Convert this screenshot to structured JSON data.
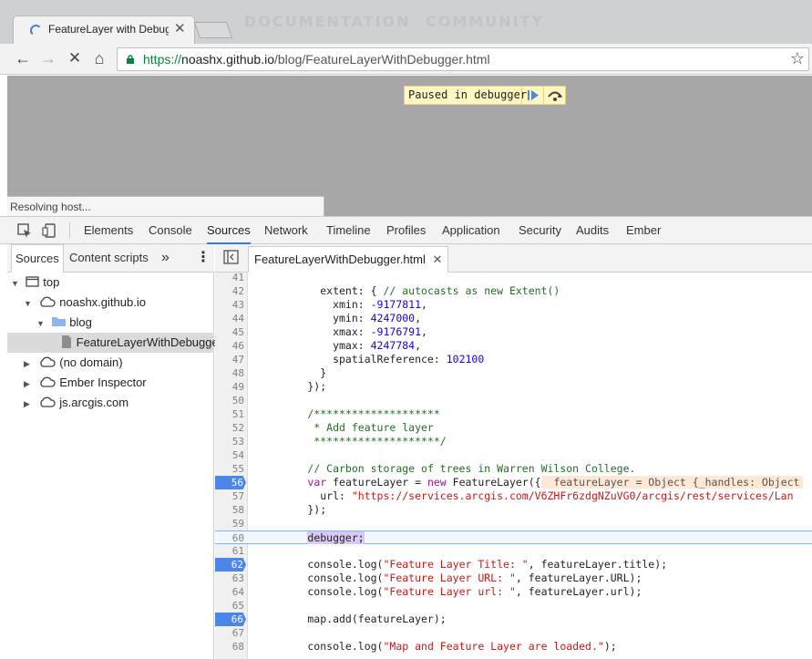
{
  "browser": {
    "tab_title": "FeatureLayer with Debugger",
    "ghost_tabs": [
      "DOCUMENTATION",
      "COMMUNITY"
    ],
    "url_scheme": "https://",
    "url_host": "noashx.github.io",
    "url_path": "/blog/FeatureLayerWithDebugger.html"
  },
  "page": {
    "paused_label": "Paused in debugger",
    "status": "Resolving host..."
  },
  "devtools": {
    "tabs": [
      "Elements",
      "Console",
      "Sources",
      "Network",
      "Timeline",
      "Profiles",
      "Application",
      "Security",
      "Audits",
      "Ember"
    ],
    "active_tab": "Sources",
    "navigator": {
      "tabs": [
        "Sources",
        "Content scripts"
      ],
      "more": "»",
      "tree": [
        {
          "label": "top"
        },
        {
          "label": "noashx.github.io"
        },
        {
          "label": "blog"
        },
        {
          "label": "FeatureLayerWithDebugger.html"
        },
        {
          "label": "(no domain)"
        },
        {
          "label": "Ember Inspector"
        },
        {
          "label": "js.arcgis.com"
        }
      ]
    },
    "editor": {
      "file_tab": "FeatureLayerWithDebugger.html",
      "lines": [
        {
          "n": "41",
          "t": ""
        },
        {
          "n": "42",
          "t": "          extent: { // autocasts as new Extent()"
        },
        {
          "n": "43",
          "t": "            xmin: -9177811,"
        },
        {
          "n": "44",
          "t": "            ymin: 4247000,"
        },
        {
          "n": "45",
          "t": "            xmax: -9176791,"
        },
        {
          "n": "46",
          "t": "            ymax: 4247784,"
        },
        {
          "n": "47",
          "t": "            spatialReference: 102100"
        },
        {
          "n": "48",
          "t": "          }"
        },
        {
          "n": "49",
          "t": "        });"
        },
        {
          "n": "50",
          "t": ""
        },
        {
          "n": "51",
          "t": "        /********************"
        },
        {
          "n": "52",
          "t": "         * Add feature layer"
        },
        {
          "n": "53",
          "t": "         ********************/"
        },
        {
          "n": "54",
          "t": ""
        },
        {
          "n": "55",
          "t": "        // Carbon storage of trees in Warren Wilson College."
        },
        {
          "n": "56",
          "t": "        var featureLayer = new FeatureLayer({",
          "inline": "featureLayer = Object {_handles: Object"
        },
        {
          "n": "57",
          "t": "          url: \"https://services.arcgis.com/V6ZHFr6zdgNZuVG0/arcgis/rest/services/Lan"
        },
        {
          "n": "58",
          "t": "        });"
        },
        {
          "n": "59",
          "t": ""
        },
        {
          "n": "60",
          "t": "        debugger;"
        },
        {
          "n": "61",
          "t": ""
        },
        {
          "n": "62",
          "t": "        console.log(\"Feature Layer Title: \", featureLayer.title);"
        },
        {
          "n": "63",
          "t": "        console.log(\"Feature Layer URL: \", featureLayer.URL);"
        },
        {
          "n": "64",
          "t": "        console.log(\"Feature Layer url: \", featureLayer.url);"
        },
        {
          "n": "65",
          "t": ""
        },
        {
          "n": "66",
          "t": "        map.add(featureLayer);"
        },
        {
          "n": "67",
          "t": ""
        },
        {
          "n": "68",
          "t": "        console.log(\"Map and Feature Layer are loaded.\");"
        }
      ],
      "breakpoints": [
        "56",
        "62",
        "66"
      ],
      "current_line": "60"
    }
  }
}
